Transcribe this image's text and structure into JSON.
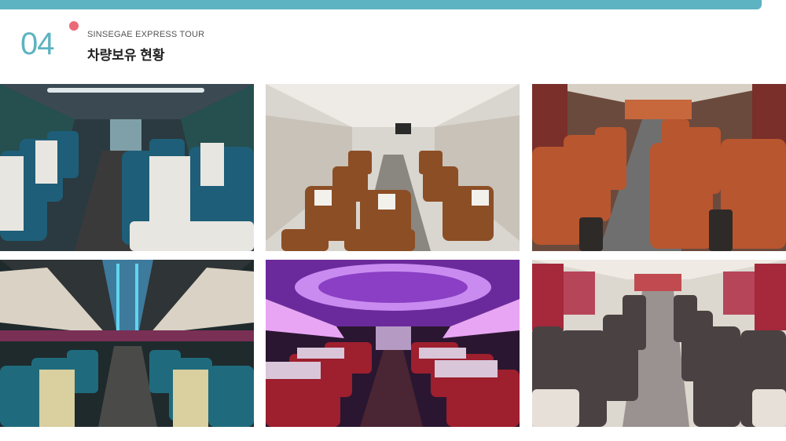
{
  "header": {
    "section_number": "04",
    "eyebrow": "SINSEGAE EXPRESS TOUR",
    "title": "차량보유 현황"
  },
  "colors": {
    "accent": "#5db3c1",
    "dot": "#ea6a76"
  },
  "photos": [
    {
      "subject": "bus-interior-teal-seats"
    },
    {
      "subject": "bus-interior-brown-seats"
    },
    {
      "subject": "bus-interior-orange-leather-seats"
    },
    {
      "subject": "bus-interior-led-ceiling-teal-seats"
    },
    {
      "subject": "bus-interior-purple-led-red-seats"
    },
    {
      "subject": "bus-interior-grey-seats-red-curtains"
    }
  ]
}
